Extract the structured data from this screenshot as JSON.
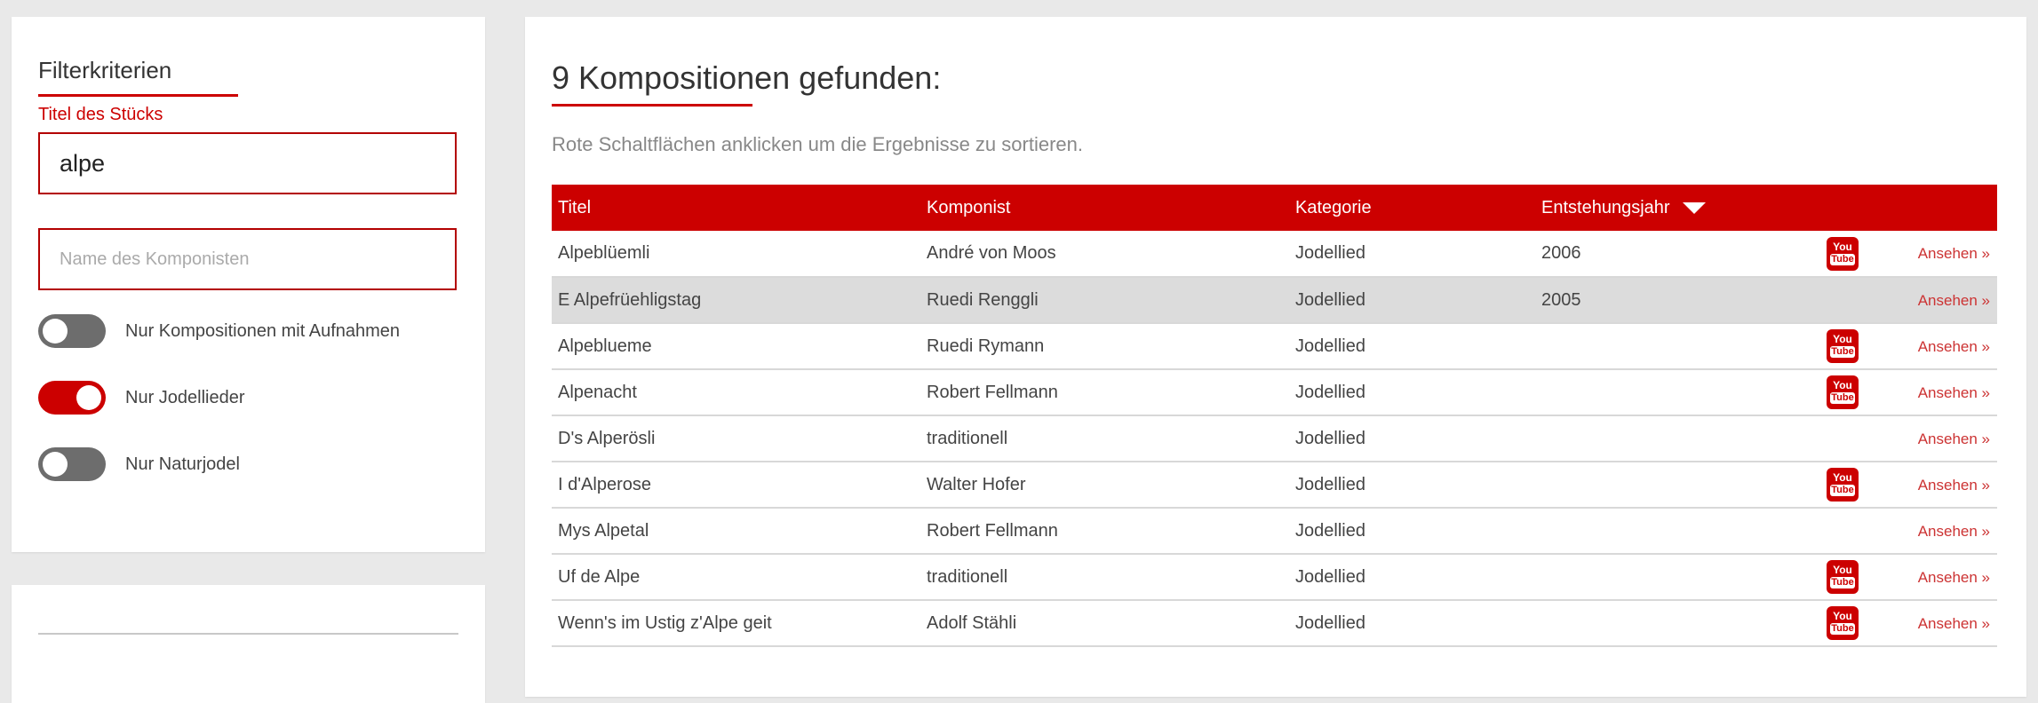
{
  "filter": {
    "heading": "Filterkriterien",
    "title_label": "Titel des Stücks",
    "title_value": "alpe",
    "composer_placeholder": "Name des Komponisten",
    "toggles": [
      {
        "label": "Nur Kompositionen mit Aufnahmen",
        "state": "off"
      },
      {
        "label": "Nur Jodellieder",
        "state": "on"
      },
      {
        "label": "Nur Naturjodel",
        "state": "off"
      }
    ]
  },
  "results": {
    "heading": "9 Kompositionen gefunden:",
    "hint": "Rote Schaltflächen anklicken um die Ergebnisse zu sortieren.",
    "columns": [
      "Titel",
      "Komponist",
      "Kategorie",
      "Entstehungsjahr"
    ],
    "youtube_top": "You",
    "youtube_bottom": "Tube",
    "view_label": "Ansehen »",
    "rows": [
      {
        "title": "Alpeblüemli",
        "composer": "André von Moos",
        "category": "Jodellied",
        "year": "2006",
        "youtube": true
      },
      {
        "title": "E Alpefrüehligstag",
        "composer": "Ruedi Renggli",
        "category": "Jodellied",
        "year": "2005",
        "youtube": false
      },
      {
        "title": "Alpeblueme",
        "composer": "Ruedi Rymann",
        "category": "Jodellied",
        "year": "",
        "youtube": true
      },
      {
        "title": "Alpenacht",
        "composer": "Robert Fellmann",
        "category": "Jodellied",
        "year": "",
        "youtube": true
      },
      {
        "title": "D's Alperösli",
        "composer": "traditionell",
        "category": "Jodellied",
        "year": "",
        "youtube": false
      },
      {
        "title": "I d'Alperose",
        "composer": "Walter Hofer",
        "category": "Jodellied",
        "year": "",
        "youtube": true
      },
      {
        "title": "Mys Alpetal",
        "composer": "Robert Fellmann",
        "category": "Jodellied",
        "year": "",
        "youtube": false
      },
      {
        "title": "Uf de Alpe",
        "composer": "traditionell",
        "category": "Jodellied",
        "year": "",
        "youtube": true
      },
      {
        "title": "Wenn's im Ustig z'Alpe geit",
        "composer": "Adolf Stähli",
        "category": "Jodellied",
        "year": "",
        "youtube": true
      }
    ]
  },
  "colors": {
    "accent": "#cc0000",
    "background": "#e9e9e9"
  }
}
